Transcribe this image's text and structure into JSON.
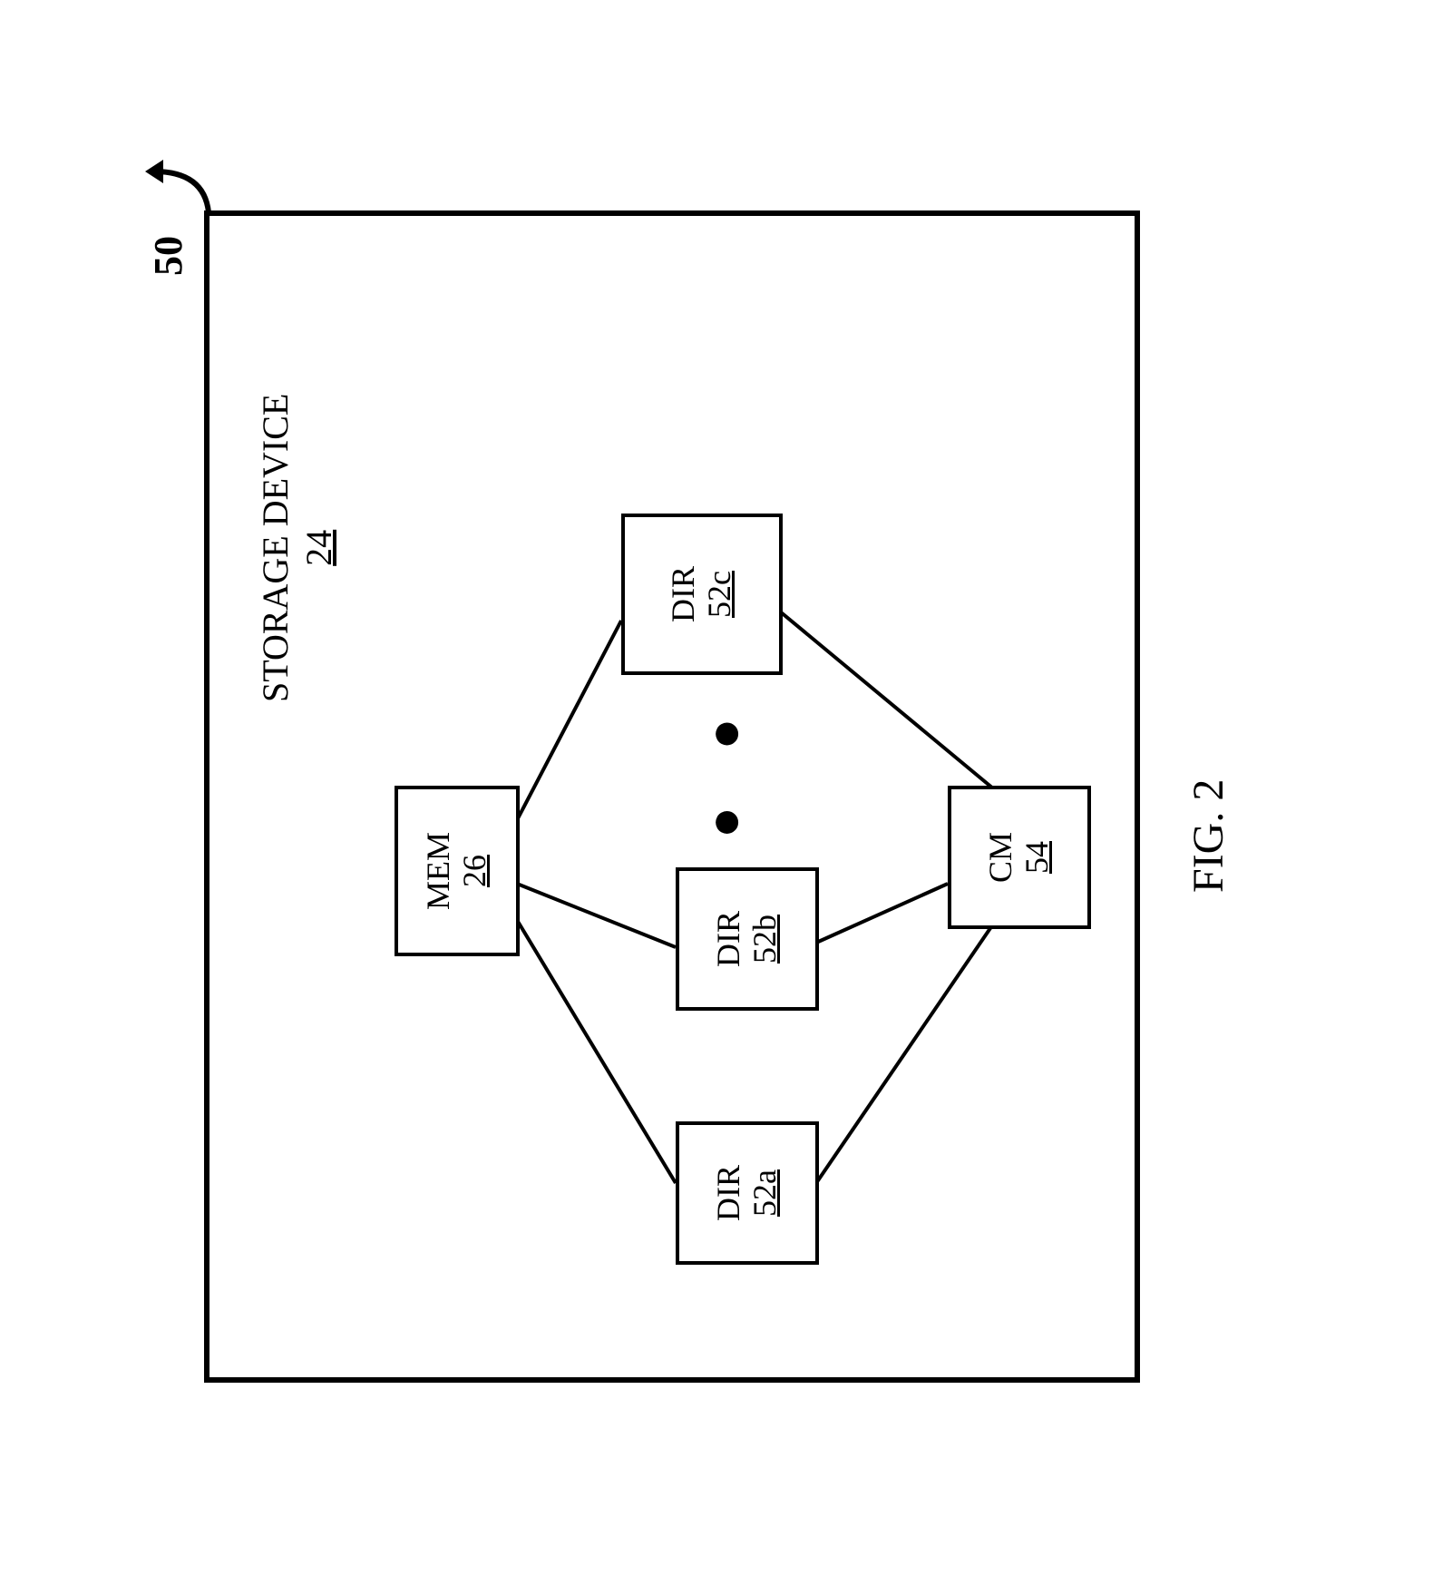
{
  "figure": {
    "ref_label": "50",
    "caption": "FIG. 2"
  },
  "storage": {
    "title": "STORAGE DEVICE",
    "ref": "24"
  },
  "mem": {
    "label": "MEM",
    "ref": "26"
  },
  "dir_a": {
    "label": "DIR",
    "ref": "52a"
  },
  "dir_b": {
    "label": "DIR",
    "ref": "52b"
  },
  "dir_c": {
    "label": "DIR",
    "ref": "52c"
  },
  "cm": {
    "label": "CM",
    "ref": "54"
  },
  "ellipsis": "● ● ●"
}
